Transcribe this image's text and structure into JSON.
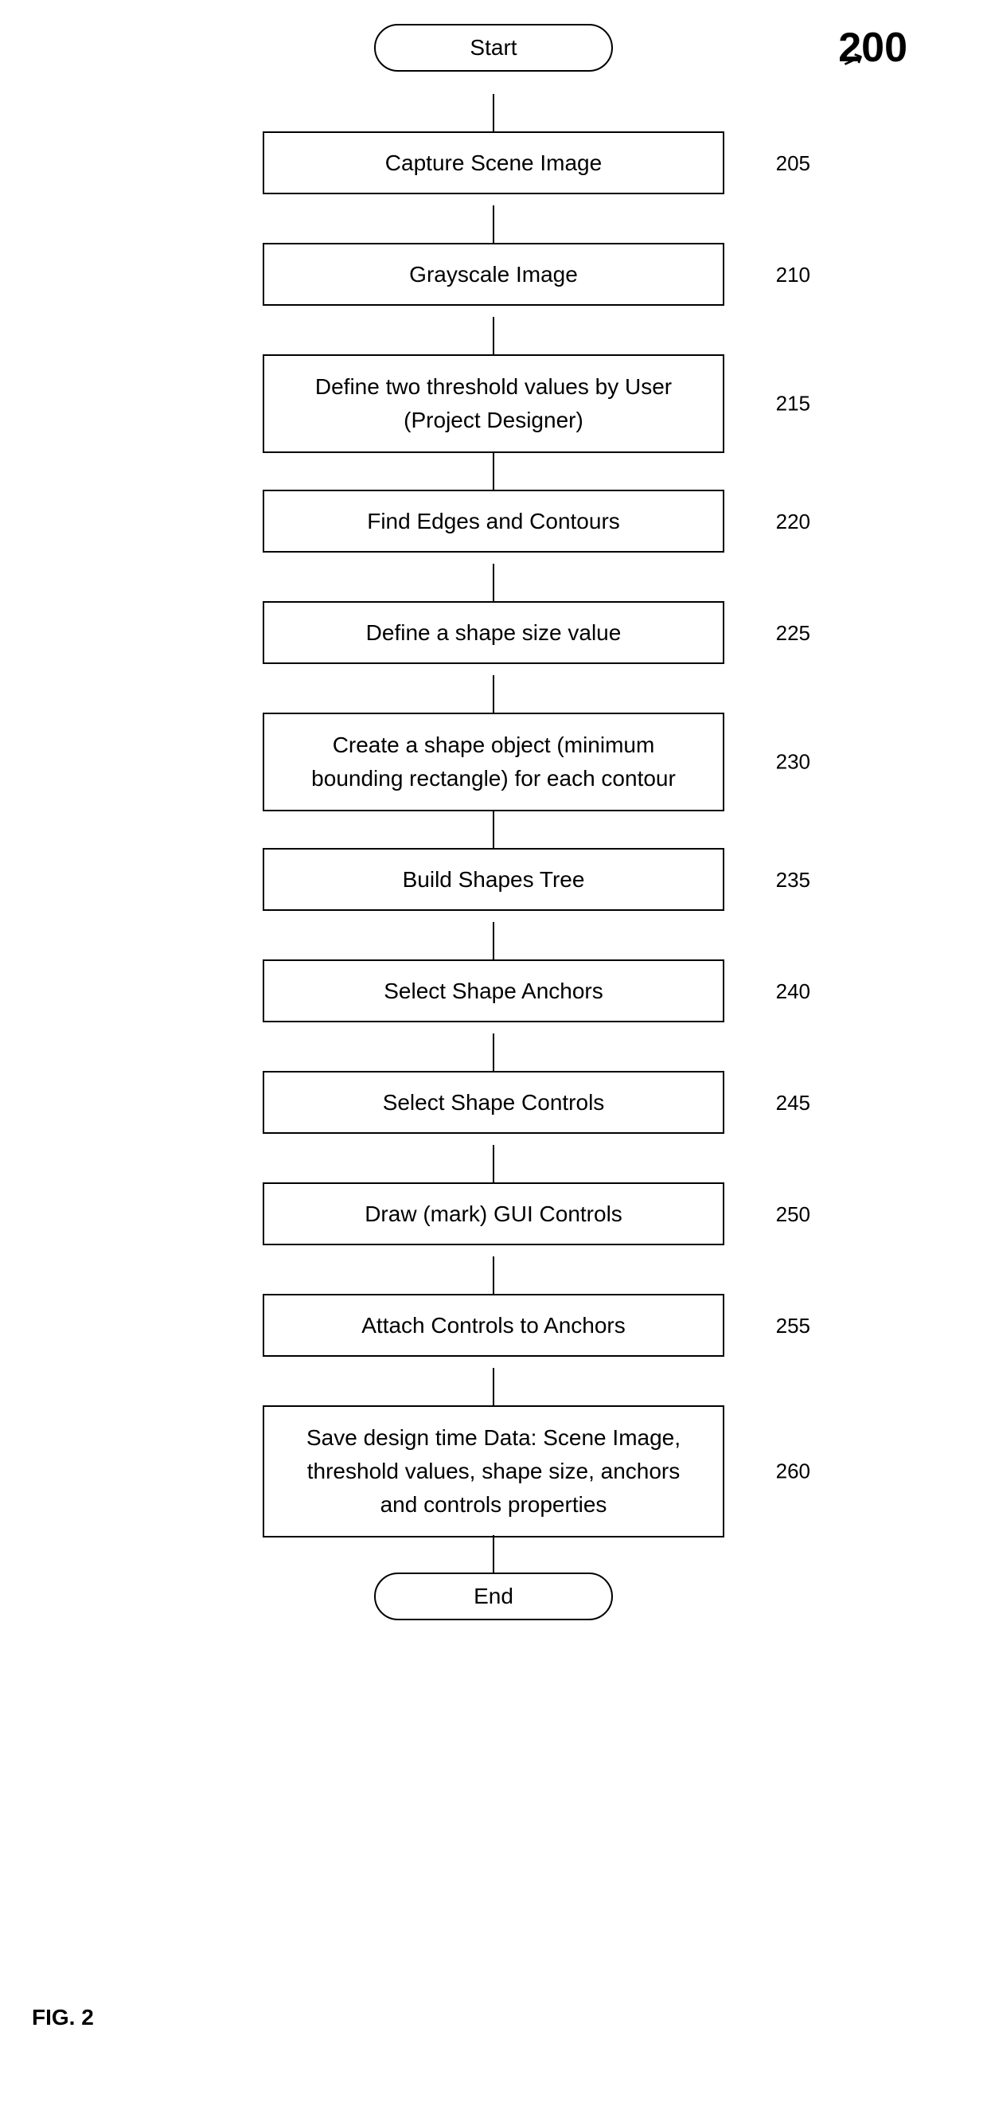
{
  "diagram": {
    "figure_label": "FIG. 2",
    "figure_number": "200",
    "steps": [
      {
        "id": "start",
        "type": "rounded",
        "label": "Start",
        "ref": null
      },
      {
        "id": "step205",
        "type": "rect",
        "label": "Capture Scene Image",
        "ref": "205"
      },
      {
        "id": "step210",
        "type": "rect",
        "label": "Grayscale Image",
        "ref": "210"
      },
      {
        "id": "step215",
        "type": "rect",
        "label": "Define two threshold values by User\n(Project Designer)",
        "ref": "215"
      },
      {
        "id": "step220",
        "type": "rect",
        "label": "Find Edges and Contours",
        "ref": "220"
      },
      {
        "id": "step225",
        "type": "rect",
        "label": "Define a shape size value",
        "ref": "225"
      },
      {
        "id": "step230",
        "type": "rect",
        "label": "Create a shape object (minimum\nbounding rectangle) for each contour",
        "ref": "230"
      },
      {
        "id": "step235",
        "type": "rect",
        "label": "Build Shapes Tree",
        "ref": "235"
      },
      {
        "id": "step240",
        "type": "rect",
        "label": "Select Shape Anchors",
        "ref": "240"
      },
      {
        "id": "step245",
        "type": "rect",
        "label": "Select Shape Controls",
        "ref": "245"
      },
      {
        "id": "step250",
        "type": "rect",
        "label": "Draw (mark) GUI Controls",
        "ref": "250"
      },
      {
        "id": "step255",
        "type": "rect",
        "label": "Attach Controls to Anchors",
        "ref": "255"
      },
      {
        "id": "step260",
        "type": "rect",
        "label": "Save design time Data: Scene Image,\nthreshold values, shape size, anchors\nand controls properties",
        "ref": "260"
      },
      {
        "id": "end",
        "type": "rounded",
        "label": "End",
        "ref": null
      }
    ]
  }
}
